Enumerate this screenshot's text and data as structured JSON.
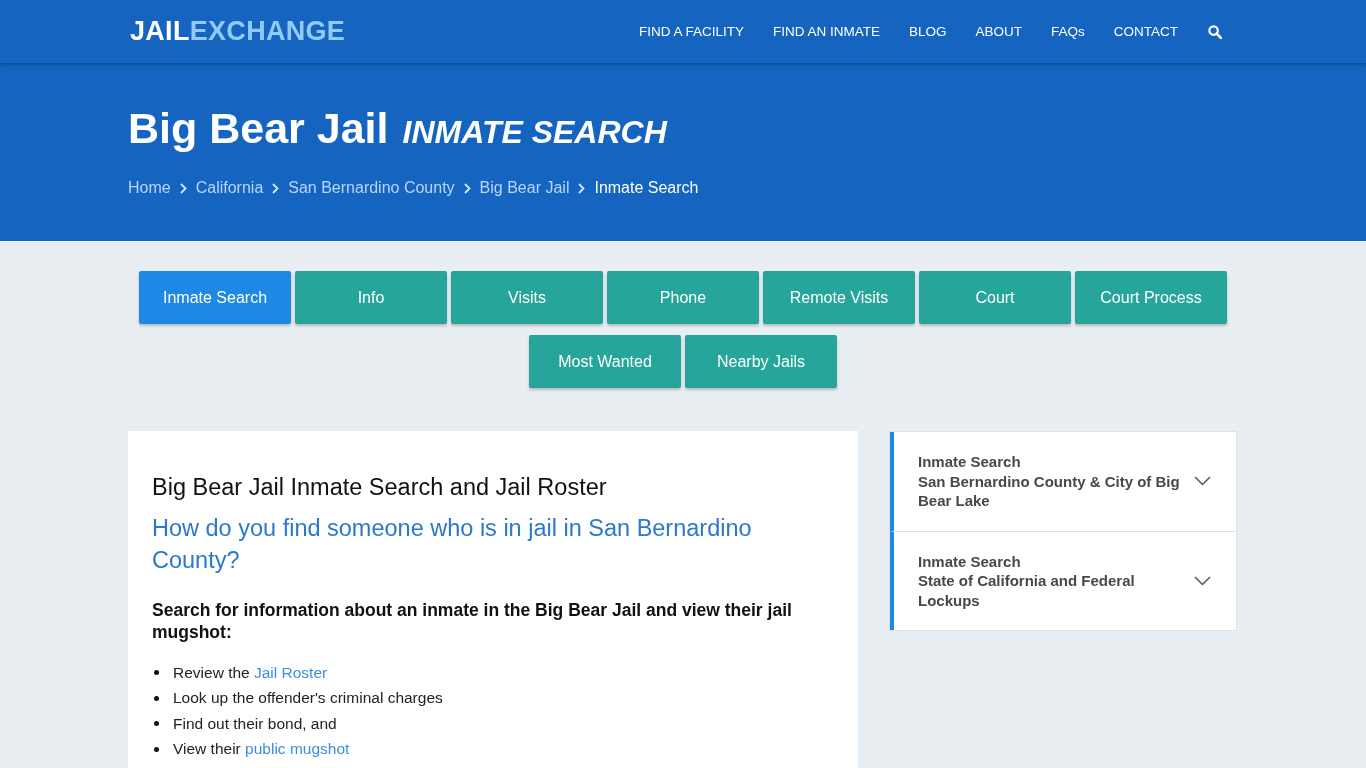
{
  "header": {
    "logo": {
      "first": "JAIL",
      "second": "EXCHANGE"
    },
    "nav": [
      "FIND A FACILITY",
      "FIND AN INMATE",
      "BLOG",
      "ABOUT",
      "FAQs",
      "CONTACT"
    ]
  },
  "hero": {
    "title": "Big Bear Jail",
    "subtitle": "INMATE SEARCH",
    "breadcrumb": [
      {
        "label": "Home",
        "current": false
      },
      {
        "label": "California",
        "current": false
      },
      {
        "label": "San Bernardino County",
        "current": false
      },
      {
        "label": "Big Bear Jail",
        "current": false
      },
      {
        "label": "Inmate Search",
        "current": true
      }
    ]
  },
  "tabs": [
    {
      "label": "Inmate Search",
      "selected": true
    },
    {
      "label": "Info",
      "selected": false
    },
    {
      "label": "Visits",
      "selected": false
    },
    {
      "label": "Phone",
      "selected": false
    },
    {
      "label": "Remote Visits",
      "selected": false
    },
    {
      "label": "Court",
      "selected": false
    },
    {
      "label": "Court Process",
      "selected": false
    },
    {
      "label": "Most Wanted",
      "selected": false
    },
    {
      "label": "Nearby Jails",
      "selected": false
    }
  ],
  "article": {
    "heading": "Big Bear Jail Inmate Search and Jail Roster",
    "question": "How do you find someone who is in jail in San Bernardino County?",
    "intro": "Search for information about an inmate in the Big Bear Jail and view their jail mugshot:",
    "list": [
      {
        "text": "Review the",
        "link": "Jail Roster"
      },
      {
        "text": "Look up the offender's criminal charges"
      },
      {
        "text": "Find out their bond, and"
      },
      {
        "text": "View their",
        "link": "public mugshot"
      }
    ]
  },
  "sidebar": {
    "items": [
      {
        "title": "Inmate Search",
        "subtitle": "San Bernardino County & City of Big Bear Lake",
        "expanded": false
      },
      {
        "title": "Inmate Search",
        "subtitle": "State of California and Federal Lockups",
        "expanded": false
      }
    ]
  }
}
